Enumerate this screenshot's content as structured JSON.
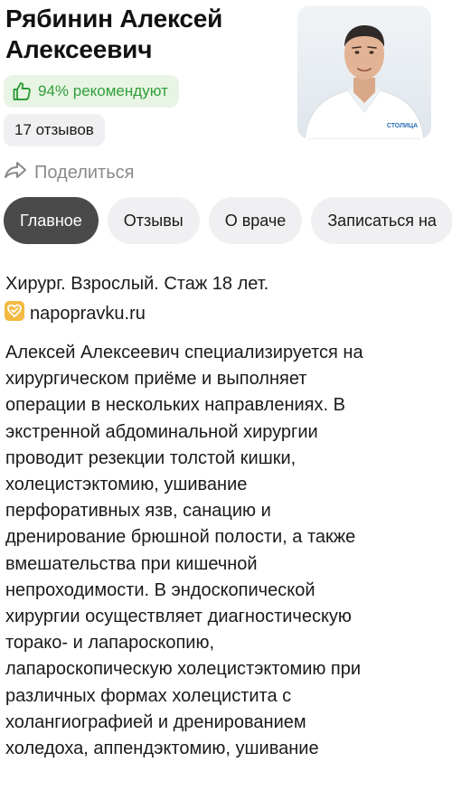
{
  "doctor": {
    "name_line1": "Рябинин Алексей",
    "name_line2": "Алексеевич",
    "recommend": "94% рекомендуют",
    "reviews": "17 отзывов",
    "share": "Поделиться",
    "photo_icon": "doctor-portrait",
    "photo_logo_text": "СТОЛИЦА"
  },
  "tabs": [
    {
      "label": "Главное",
      "active": true
    },
    {
      "label": "Отзывы",
      "active": false
    },
    {
      "label": "О враче",
      "active": false
    },
    {
      "label": "Записаться на",
      "active": false
    }
  ],
  "summary": "Хирург. Взрослый. Стаж 18 лет.",
  "source": {
    "label": "napopravku.ru",
    "icon": "napopravku-logo-icon"
  },
  "description_lines": [
    "Алексей Алексеевич специализируется на",
    "хирургическом приёме и выполняет",
    "операции в нескольких направлениях. В",
    "экстренной абдоминальной хирургии",
    "проводит резекции толстой кишки,",
    "холецистэктомию, ушивание",
    "перфоративных язв, санацию и",
    "дренирование брюшной полости, а также",
    "вмешательства при кишечной",
    "непроходимости. В эндоскопической",
    "хирургии осуществляет диагностическую",
    "торако- и лапароскопию,",
    "лапароскопическую холецистэктомию при",
    "различных формах холецистита с",
    "холангиографией и дренированием",
    "холедоха, аппендэктомию, ушивание"
  ],
  "colors": {
    "recommend_bg": "#e9f5e4",
    "recommend_text": "#2f9e3a",
    "tab_active_bg": "#4a4a4a",
    "tab_bg": "#f0f0f2",
    "source_icon": "#f4b942"
  }
}
